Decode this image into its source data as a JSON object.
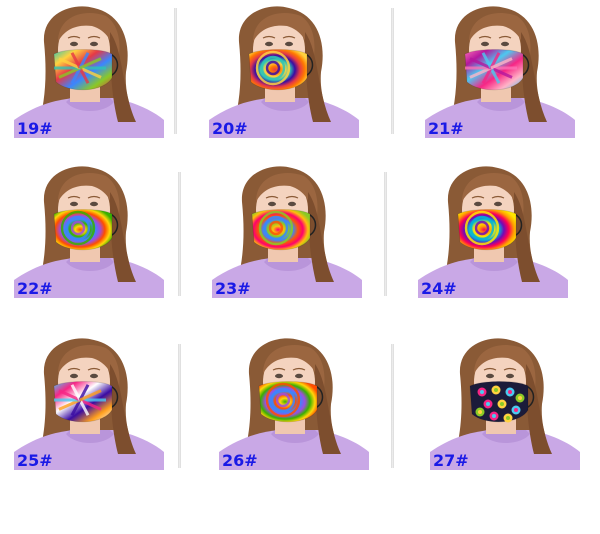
{
  "products": [
    {
      "label": "19#",
      "colors": [
        "#2ec4b6",
        "#ffd23f",
        "#e63946",
        "#3a86ff",
        "#8ac926"
      ],
      "pattern": "burst"
    },
    {
      "label": "20#",
      "colors": [
        "#e63946",
        "#ff7b00",
        "#ffd23f",
        "#2ec4b6",
        "#3a0ca3"
      ],
      "pattern": "spiral"
    },
    {
      "label": "21#",
      "colors": [
        "#ff6fb5",
        "#b5179e",
        "#4cc9f0",
        "#f72585",
        "#ffb3c6"
      ],
      "pattern": "burst"
    },
    {
      "label": "22#",
      "colors": [
        "#ff4d00",
        "#ffd60a",
        "#38b000",
        "#3a86ff",
        "#9d4edd"
      ],
      "pattern": "spiral"
    },
    {
      "label": "23#",
      "colors": [
        "#ff006e",
        "#ffbe0b",
        "#8ac926",
        "#3a86ff",
        "#fb5607"
      ],
      "pattern": "spiral"
    },
    {
      "label": "24#",
      "colors": [
        "#ff0054",
        "#ff9e00",
        "#ffe600",
        "#00b4d8",
        "#7209b7"
      ],
      "pattern": "spiral"
    },
    {
      "label": "25#",
      "colors": [
        "#4cc9f0",
        "#f72585",
        "#ffffff",
        "#3a0ca3",
        "#ff9f1c"
      ],
      "pattern": "burst"
    },
    {
      "label": "26#",
      "colors": [
        "#38b000",
        "#ffd60a",
        "#ff4d00",
        "#3a86ff",
        "#9d4edd"
      ],
      "pattern": "spiral"
    },
    {
      "label": "27#",
      "colors": [
        "#1b1b3a",
        "#f72585",
        "#ffd23f",
        "#4cc9f0",
        "#8ac926"
      ],
      "pattern": "dots"
    }
  ]
}
